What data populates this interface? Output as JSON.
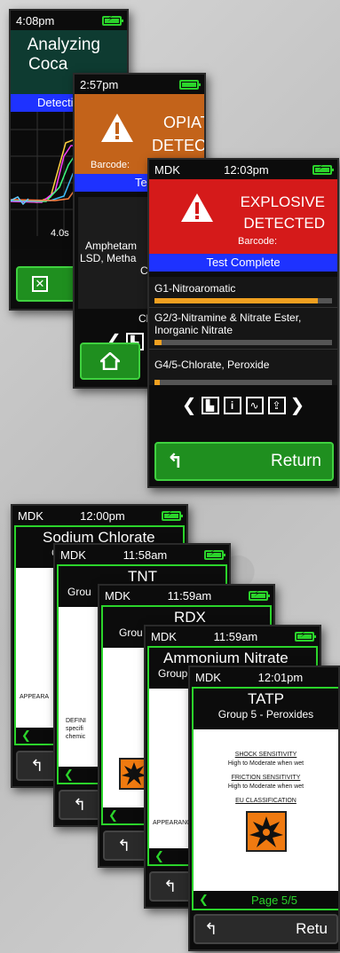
{
  "devices_top": {
    "analyzing": {
      "time": "4:08pm",
      "title_line1": "Analyzing",
      "title_line2": "Coca",
      "blue_bar": "Detecti",
      "axis_label": "4.0s"
    },
    "opiates": {
      "time": "2:57pm",
      "alert_line1": "OPIATES",
      "alert_line2": "DETECTED",
      "barcode": "Barcode: ",
      "blue_bar": "Te",
      "body_line1": "Amphetam",
      "body_line2": "LSD, Metha",
      "body_line3": "C",
      "bottom_label": "Cli"
    },
    "explosive": {
      "brand": "MDK",
      "time": "12:03pm",
      "alert_line1": "EXPLOSIVE",
      "alert_line2": "DETECTED",
      "barcode": "Barcode:",
      "blue_bar": "Test Complete",
      "groups": [
        {
          "label": "G1-Nitroaromatic",
          "level": 0.92
        },
        {
          "label": "G2/3-Nitramine & Nitrate Ester, Inorganic Nitrate",
          "level": 0.04
        },
        {
          "label": "G4/5-Chlorate, Peroxide",
          "level": 0.03
        }
      ],
      "return_label": "Return"
    }
  },
  "devices_bottom": {
    "d1": {
      "time": "12:00pm",
      "title": "Sodium Chlorate",
      "subtitle": "G",
      "appearance": "APPEARA"
    },
    "d2": {
      "brand": "MDK",
      "time": "11:58am",
      "title": "TNT",
      "subtitle": "Grou",
      "def_line1": "DEFINI",
      "def_line2": "specifi",
      "def_line3": "chemic"
    },
    "d3": {
      "brand": "MDK",
      "time": "11:59am",
      "title": "RDX",
      "subtitle": "Grou"
    },
    "d4": {
      "brand": "MDK",
      "time": "11:59am",
      "title": "Ammonium Nitrate",
      "subtitle": "Group",
      "appearance": "APPEARANC"
    },
    "d5": {
      "brand": "MDK",
      "time": "12:01pm",
      "title": "TATP",
      "subtitle": "Group 5 - Peroxides",
      "shock_heading": "SHOCK SENSITIVITY",
      "shock_value": "High to Moderate when wet",
      "friction_heading": "FRICTION SENSITIVITY",
      "friction_value": "High to Moderate when wet",
      "eu_heading": "EU CLASSIFICATION",
      "page": "Page 5/5",
      "return_label": "Retu"
    },
    "d1_brand": "MDK"
  }
}
